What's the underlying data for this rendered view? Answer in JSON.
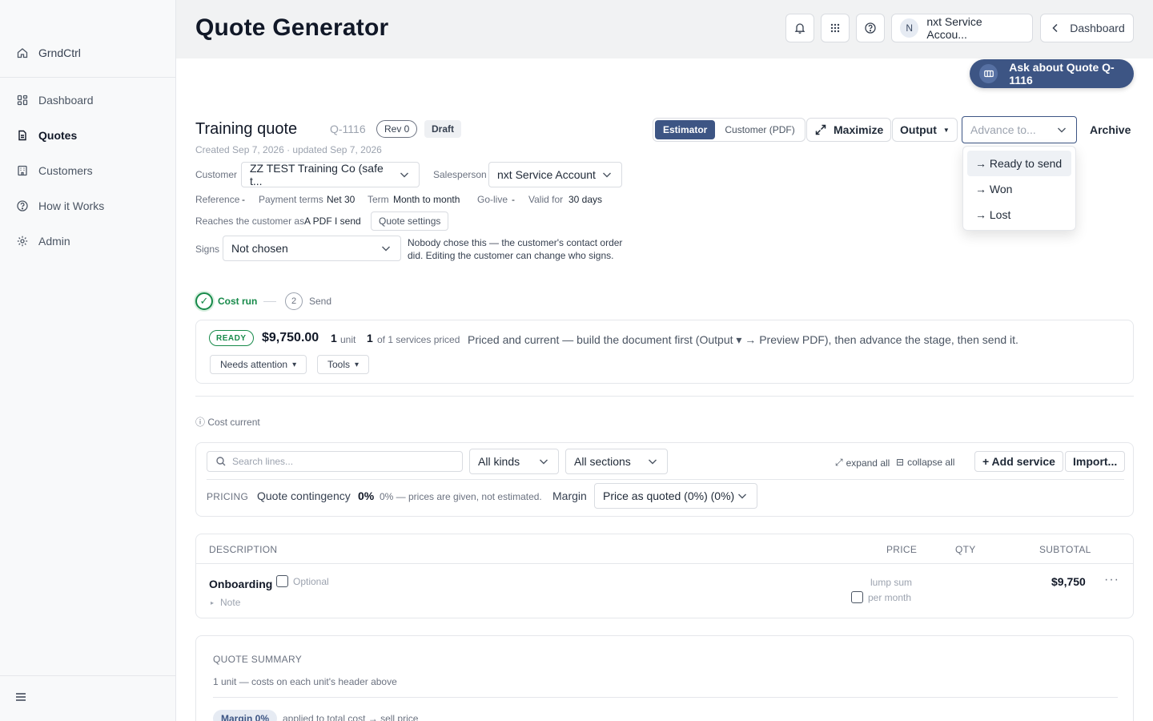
{
  "sidebar": {
    "brand": "GrndCtrl",
    "items": [
      {
        "label": "Dashboard",
        "icon": "grid-icon"
      },
      {
        "label": "Quotes",
        "icon": "document-icon"
      },
      {
        "label": "Customers",
        "icon": "building-icon"
      },
      {
        "label": "How it Works",
        "icon": "help-icon"
      },
      {
        "label": "Admin",
        "icon": "gear-icon"
      }
    ]
  },
  "header": {
    "title": "Quote Generator",
    "account_initial": "N",
    "account_name": "nxt Service Accou...",
    "dashboard_label": "Dashboard",
    "ask_label": "Ask about Quote Q-1116"
  },
  "quote": {
    "title": "Training quote",
    "id": "Q-1116",
    "rev": "Rev 0",
    "status": "Draft",
    "created": "Created Sep 7, 2026 · updated Sep 7, 2026",
    "mode_estimator": "Estimator",
    "mode_customer": "Customer (PDF)",
    "maximize": "Maximize",
    "output": "Output",
    "advance_placeholder": "Advance to...",
    "archive": "Archive",
    "advance_options": [
      "→ Ready to send",
      "→ Won",
      "→ Lost"
    ]
  },
  "fields": {
    "customer_label": "Customer",
    "customer_value": "ZZ TEST Training Co (safe t...",
    "salesperson_label": "Salesperson",
    "salesperson_value": "nxt Service Account",
    "reference_label": "Reference",
    "reference_value": "-",
    "payment_label": "Payment terms",
    "payment_value": "Net 30",
    "term_label": "Term",
    "term_value": "Month to month",
    "golive_label": "Go-live",
    "golive_value": "-",
    "valid_label": "Valid for",
    "valid_value": "30 days",
    "reaches_label": "Reaches the customer as",
    "reaches_value": "A PDF I send",
    "quote_settings": "Quote settings",
    "signs_label": "Signs",
    "signs_value": "Not chosen",
    "signs_note": "Nobody chose this — the customer's contact order did. Editing the customer can change who signs."
  },
  "stepper": {
    "step1": "Cost run",
    "step2_num": "2",
    "step2": "Send"
  },
  "status_card": {
    "badge": "READY",
    "total": "$9,750.00",
    "units_num": "1",
    "units_label": "unit",
    "priced_num": "1",
    "priced_label": "of 1 services priced",
    "message": "Priced and current — build the document first (Output ▾ → Preview PDF), then advance the stage, then send it.",
    "needs_attention": "Needs attention",
    "tools": "Tools"
  },
  "cost_current": "Cost current",
  "filters": {
    "search_placeholder": "Search lines...",
    "kinds": "All kinds",
    "sections": "All sections",
    "expand_all": "expand all",
    "collapse_all": "collapse all",
    "add_service": "+ Add service",
    "import": "Import...",
    "pricing_label": "PRICING",
    "contingency_label": "Quote contingency",
    "contingency_value": "0%",
    "contingency_note": "0% — prices are given, not estimated.",
    "margin_label": "Margin",
    "margin_value": "Price as quoted (0%) (0%)"
  },
  "table": {
    "columns": [
      "DESCRIPTION",
      "PRICE",
      "QTY",
      "SUBTOTAL"
    ],
    "rows": [
      {
        "name": "Onboarding",
        "optional": "Optional",
        "note": "Note",
        "price_type": "lump sum",
        "per_month": "per month",
        "subtotal": "$9,750"
      }
    ]
  },
  "summary": {
    "title": "QUOTE SUMMARY",
    "subtitle": "1 unit — costs on each unit's header above",
    "margin_pill": "Margin 0%",
    "applied": "applied to total cost → sell price"
  },
  "colors": {
    "accent": "#3d5584",
    "success": "#178a4a"
  }
}
